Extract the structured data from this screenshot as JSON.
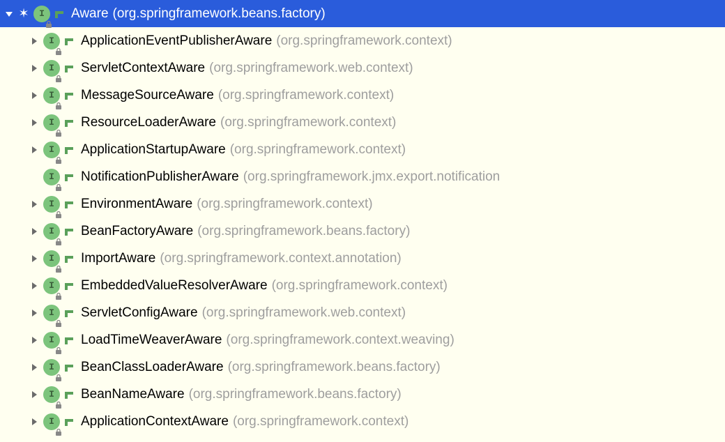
{
  "root": {
    "name": "Aware",
    "package": "(org.springframework.beans.factory)",
    "expanded": true,
    "starred": true
  },
  "children": [
    {
      "name": "ApplicationEventPublisherAware",
      "package": "(org.springframework.context)",
      "expandable": true
    },
    {
      "name": "ServletContextAware",
      "package": "(org.springframework.web.context)",
      "expandable": true
    },
    {
      "name": "MessageSourceAware",
      "package": "(org.springframework.context)",
      "expandable": true
    },
    {
      "name": "ResourceLoaderAware",
      "package": "(org.springframework.context)",
      "expandable": true
    },
    {
      "name": "ApplicationStartupAware",
      "package": "(org.springframework.context)",
      "expandable": true
    },
    {
      "name": "NotificationPublisherAware",
      "package": "(org.springframework.jmx.export.notification",
      "expandable": false
    },
    {
      "name": "EnvironmentAware",
      "package": "(org.springframework.context)",
      "expandable": true
    },
    {
      "name": "BeanFactoryAware",
      "package": "(org.springframework.beans.factory)",
      "expandable": true
    },
    {
      "name": "ImportAware",
      "package": "(org.springframework.context.annotation)",
      "expandable": true
    },
    {
      "name": "EmbeddedValueResolverAware",
      "package": "(org.springframework.context)",
      "expandable": true
    },
    {
      "name": "ServletConfigAware",
      "package": "(org.springframework.web.context)",
      "expandable": true
    },
    {
      "name": "LoadTimeWeaverAware",
      "package": "(org.springframework.context.weaving)",
      "expandable": true
    },
    {
      "name": "BeanClassLoaderAware",
      "package": "(org.springframework.beans.factory)",
      "expandable": true
    },
    {
      "name": "BeanNameAware",
      "package": "(org.springframework.beans.factory)",
      "expandable": true
    },
    {
      "name": "ApplicationContextAware",
      "package": "(org.springframework.context)",
      "expandable": true
    }
  ],
  "icons": {
    "interface_letter": "I"
  }
}
